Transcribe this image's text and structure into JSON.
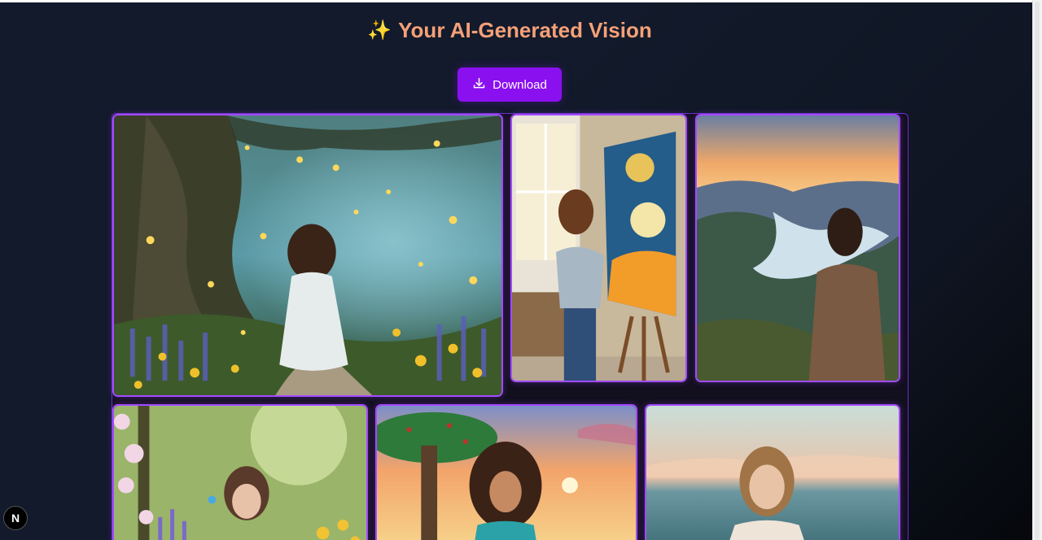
{
  "header": {
    "sparkle_icon": "✨",
    "title": "Your AI-Generated Vision"
  },
  "toolbar": {
    "download_label": "Download",
    "download_icon": "download-icon",
    "accent": "#8b10f0"
  },
  "gallery": {
    "border_color": "#a24bff",
    "images": [
      {
        "subject": "enchanted forest with fireflies, woman in white dress walking path"
      },
      {
        "subject": "woman painting moonlit tree canvas by window"
      },
      {
        "subject": "woman overlooking mountain river at sunset"
      },
      {
        "subject": "woman meditating among spring flowers"
      },
      {
        "subject": "smiling woman with curly hair under acacia tree at sunset"
      },
      {
        "subject": "woman with eyes closed by the sea at dawn"
      }
    ]
  },
  "dev_badge": {
    "label": "N"
  }
}
